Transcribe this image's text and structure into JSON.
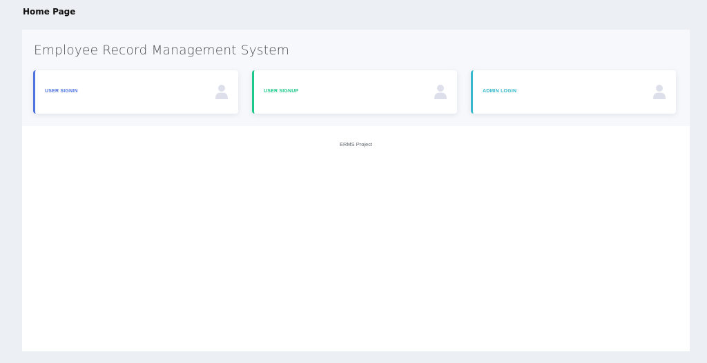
{
  "page": {
    "header": "Home Page"
  },
  "main": {
    "title": "Employee Record Management System",
    "cards": [
      {
        "label": "USER SIGNIN",
        "accent": "#4e73df",
        "icon": "user-icon"
      },
      {
        "label": "USER SIGNUP",
        "accent": "#1cc88a",
        "icon": "user-icon"
      },
      {
        "label": "ADMIN LOGIN",
        "accent": "#36b9cc",
        "icon": "user-icon"
      }
    ]
  },
  "footer": {
    "text": "ERMS Project"
  },
  "colors": {
    "background": "#eceff3",
    "panel": "#ffffff",
    "icon": "#dddfeb"
  }
}
